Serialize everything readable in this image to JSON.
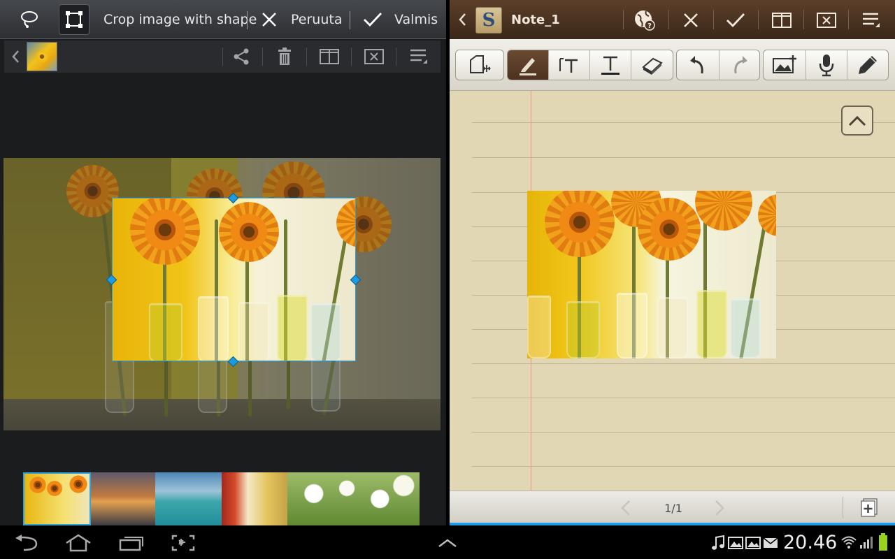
{
  "left_panel": {
    "topbar": {
      "mode_title": "Crop image with shape",
      "cancel_label": "Peruuta",
      "done_label": "Valmis",
      "lasso_icon": "lasso-icon",
      "crop_icon": "crop-rectangle-icon"
    },
    "subbar": {
      "icons": [
        "back-chevron-icon",
        "share-icon",
        "trash-icon",
        "split-view-icon",
        "close-box-icon",
        "menu-icon"
      ]
    },
    "thumbnails": [
      "sunflowers",
      "sunset",
      "beach",
      "vases",
      "tulips"
    ]
  },
  "right_panel": {
    "header": {
      "title": "Note_1",
      "app_logo_letter": "S",
      "icons": [
        "globe-help-icon",
        "close-icon",
        "check-icon",
        "split-view-icon",
        "close-box-icon",
        "menu-icon"
      ]
    },
    "toolbar": {
      "tools": [
        "select-move-icon",
        "pen-icon",
        "text-box-icon",
        "text-icon",
        "eraser-icon",
        "undo-icon",
        "redo-icon",
        "insert-image-icon",
        "microphone-icon",
        "brush-icon"
      ]
    },
    "page_indicator": "1/1"
  },
  "system_bar": {
    "time": "20.46",
    "nav_icons": [
      "back-icon",
      "home-icon",
      "recent-apps-icon",
      "screenshot-icon"
    ],
    "status_icons": [
      "music-icon",
      "gallery-icon",
      "gallery-icon",
      "email-icon",
      "wifi-icon",
      "signal-icon",
      "battery-icon"
    ]
  },
  "colors": {
    "accent_blue": "#1e9be8",
    "paper": "#e1d7b5",
    "header_brown": "#4a3322"
  }
}
